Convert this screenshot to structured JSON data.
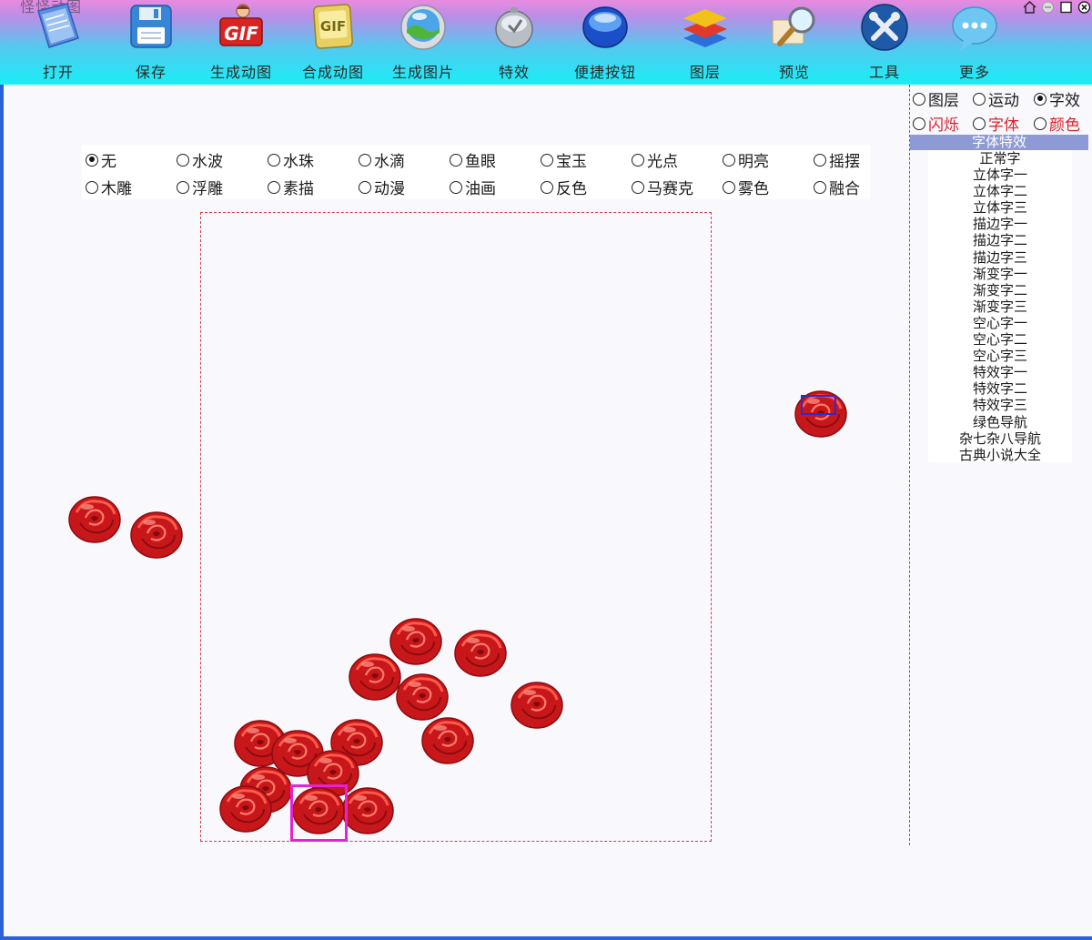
{
  "window": {
    "title": "怪怪动图"
  },
  "toolbar": {
    "items": [
      {
        "label": "打开",
        "icon": "open-folder-icon"
      },
      {
        "label": "保存",
        "icon": "floppy-disk-icon"
      },
      {
        "label": "生成动图",
        "icon": "gif-badge-icon"
      },
      {
        "label": "合成动图",
        "icon": "gif-compose-icon"
      },
      {
        "label": "生成图片",
        "icon": "landscape-orb-icon"
      },
      {
        "label": "特效",
        "icon": "silver-fx-icon"
      },
      {
        "label": "便捷按钮",
        "icon": "blue-oval-button-icon"
      },
      {
        "label": "图层",
        "icon": "layers-stack-icon"
      },
      {
        "label": "预览",
        "icon": "magnifier-icon"
      },
      {
        "label": "工具",
        "icon": "wrench-tools-icon"
      },
      {
        "label": "更多",
        "icon": "chat-bubble-icon"
      }
    ]
  },
  "filters": {
    "row1": [
      {
        "label": "无",
        "checked": true
      },
      {
        "label": "水波",
        "checked": false
      },
      {
        "label": "水珠",
        "checked": false
      },
      {
        "label": "水滴",
        "checked": false
      },
      {
        "label": "鱼眼",
        "checked": false
      },
      {
        "label": "宝玉",
        "checked": false
      },
      {
        "label": "光点",
        "checked": false
      },
      {
        "label": "明亮",
        "checked": false
      },
      {
        "label": "摇摆",
        "checked": false
      }
    ],
    "row2": [
      {
        "label": "木雕",
        "checked": false
      },
      {
        "label": "浮雕",
        "checked": false
      },
      {
        "label": "素描",
        "checked": false
      },
      {
        "label": "动漫",
        "checked": false
      },
      {
        "label": "油画",
        "checked": false
      },
      {
        "label": "反色",
        "checked": false
      },
      {
        "label": "马赛克",
        "checked": false
      },
      {
        "label": "雾色",
        "checked": false
      },
      {
        "label": "融合",
        "checked": false
      }
    ]
  },
  "right_panel": {
    "tabs_row1": [
      {
        "label": "图层",
        "checked": false
      },
      {
        "label": "运动",
        "checked": false
      },
      {
        "label": "字效",
        "checked": true
      }
    ],
    "tabs_row2": [
      {
        "label": "闪烁",
        "checked": false
      },
      {
        "label": "字体",
        "checked": false
      },
      {
        "label": "颜色",
        "checked": false
      }
    ],
    "list_header": "字体特效",
    "items": [
      "正常字",
      "立体字一",
      "立体字二",
      "立体字三",
      "描边字一",
      "描边字二",
      "描边字三",
      "渐变字一",
      "渐变字二",
      "渐变字三",
      "空心字一",
      "空心字二",
      "空心字三",
      "特效字一",
      "特效字二",
      "特效字三",
      "绿色导航",
      "杂七杂八导航",
      "古典小说大全"
    ]
  },
  "colors": {
    "toolbar_top": "#e88be0",
    "toolbar_bottom": "#19eef5",
    "canvas_border": "#d0404a",
    "selection_pink": "#e323d4",
    "selection_blue": "#2a2ad8",
    "rose": "#c8171a",
    "list_header_bg": "#8e9ad6",
    "highlight_red": "#e0202a"
  }
}
